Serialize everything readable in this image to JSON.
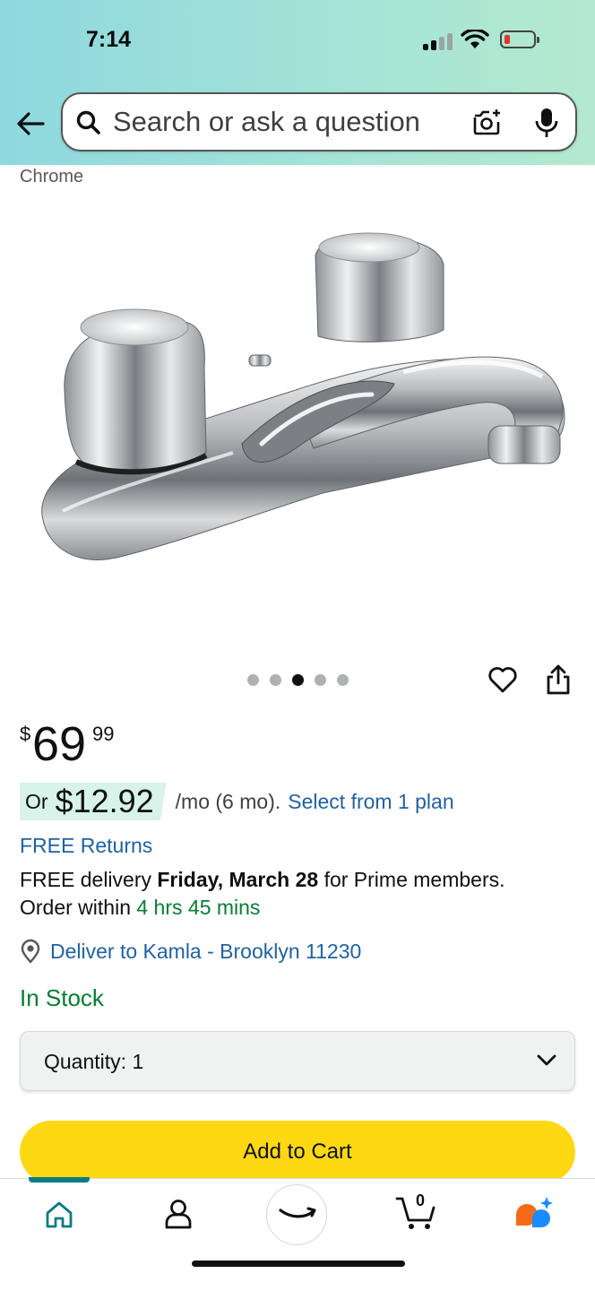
{
  "status_bar": {
    "time": "7:14"
  },
  "search": {
    "placeholder": "Search or ask a question"
  },
  "source_label": "Chrome",
  "product": {
    "image_pager": {
      "count": 5,
      "active_index": 2
    }
  },
  "price": {
    "symbol": "$",
    "whole": "69",
    "fraction": "99"
  },
  "installment": {
    "or_label": "Or",
    "amount": "$12.92",
    "term": "/mo (6 mo).",
    "link": "Select from 1 plan"
  },
  "free_returns": "FREE Returns",
  "delivery": {
    "prefix": "FREE delivery",
    "date": "Friday, March 28",
    "suffix": "for Prime members.",
    "order_within_label": "Order within",
    "countdown": "4 hrs 45 mins"
  },
  "deliver_to": "Deliver to Kamla - Brooklyn 11230",
  "stock_status": "In Stock",
  "quantity": {
    "label": "Quantity:",
    "value": "1"
  },
  "add_to_cart": "Add to Cart",
  "nav": {
    "cart_count": "0"
  },
  "colors": {
    "accent_yellow": "#ffd814",
    "link_blue": "#2162a1",
    "stock_green": "#067d34",
    "header_gradient_start": "#8fd8df",
    "header_gradient_end": "#b4e9cf"
  },
  "icons": [
    "back-arrow-icon",
    "search-icon",
    "camera-icon",
    "mic-icon",
    "heart-icon",
    "share-icon",
    "location-pin-icon",
    "chevron-down-icon",
    "home-icon",
    "account-icon",
    "amazon-smile-icon",
    "cart-icon",
    "rufus-icon"
  ]
}
